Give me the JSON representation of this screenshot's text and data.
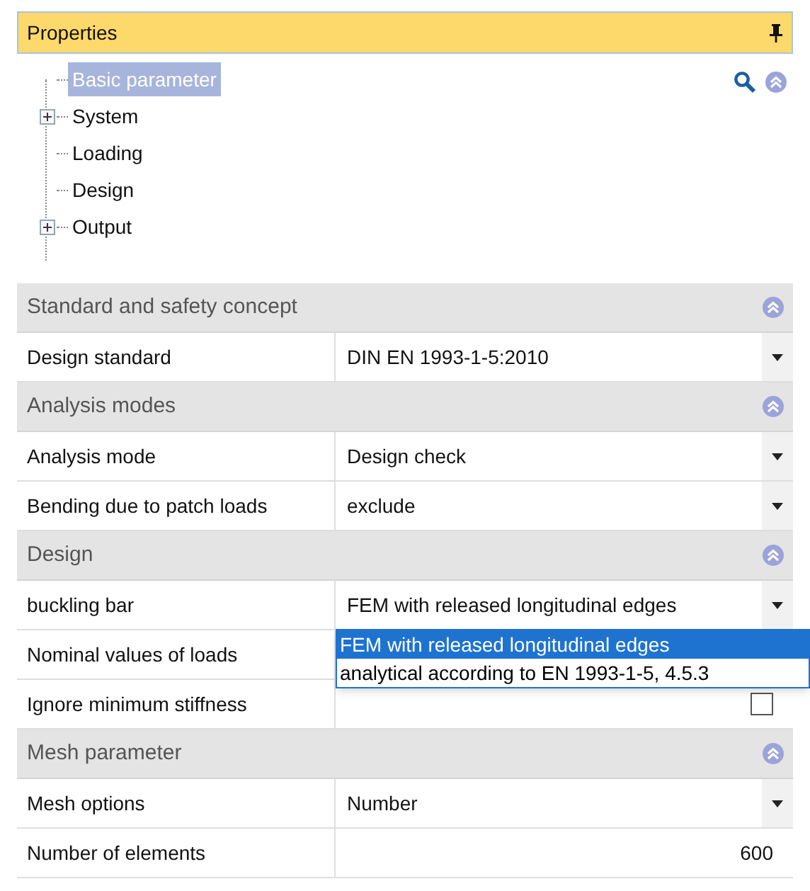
{
  "panel": {
    "title": "Properties"
  },
  "tree": [
    {
      "label": "Basic parameter",
      "selected": true,
      "expandable": false
    },
    {
      "label": "System",
      "selected": false,
      "expandable": true
    },
    {
      "label": "Loading",
      "selected": false,
      "expandable": false
    },
    {
      "label": "Design",
      "selected": false,
      "expandable": false
    },
    {
      "label": "Output",
      "selected": false,
      "expandable": true
    }
  ],
  "sections": [
    {
      "title": "Standard and safety concept",
      "rows": [
        {
          "label": "Design standard",
          "kind": "dropdown",
          "value": "DIN EN 1993-1-5:2010"
        }
      ]
    },
    {
      "title": "Analysis modes",
      "rows": [
        {
          "label": "Analysis mode",
          "kind": "dropdown",
          "value": "Design check"
        },
        {
          "label": "Bending due to patch loads",
          "kind": "dropdown",
          "value": "exclude"
        }
      ]
    },
    {
      "title": "Design",
      "rows": [
        {
          "label": "buckling bar",
          "kind": "dropdown",
          "value": "FEM with released longitudinal edges",
          "open": true,
          "options": [
            {
              "label": "FEM with released longitudinal edges",
              "selected": true
            },
            {
              "label": "analytical according to EN 1993-1-5, 4.5.3",
              "selected": false
            }
          ]
        },
        {
          "label": "Nominal values of loads",
          "kind": "hidden"
        },
        {
          "label": "Ignore minimum stiffness",
          "kind": "checkbox",
          "checked": false
        }
      ]
    },
    {
      "title": "Mesh parameter",
      "rows": [
        {
          "label": "Mesh options",
          "kind": "dropdown",
          "value": "Number"
        },
        {
          "label": "Number of elements",
          "kind": "number",
          "value": "600"
        }
      ]
    }
  ]
}
